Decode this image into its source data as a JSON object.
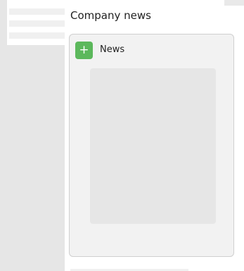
{
  "header": {
    "title": "Company news"
  },
  "news_card": {
    "add_icon_glyph": "+",
    "title": "News",
    "accent_color": "#5cb85c"
  }
}
